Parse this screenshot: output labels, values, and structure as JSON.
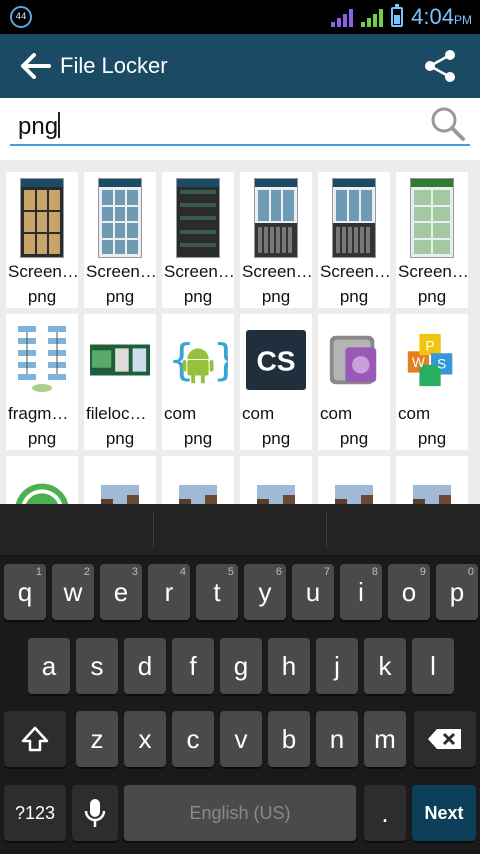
{
  "status": {
    "badge": "44",
    "time": "4:04",
    "ampm": "PM"
  },
  "app": {
    "title": "File Locker"
  },
  "search": {
    "value": "png"
  },
  "files": [
    {
      "name": "Screen…",
      "ext": "png",
      "thumb": "screenshot-grid"
    },
    {
      "name": "Screen…",
      "ext": "png",
      "thumb": "screenshot-light"
    },
    {
      "name": "Screen…",
      "ext": "png",
      "thumb": "screenshot-dark"
    },
    {
      "name": "Screen…",
      "ext": "png",
      "thumb": "screenshot-keyboard"
    },
    {
      "name": "Screen…",
      "ext": "png",
      "thumb": "screenshot-keyboard"
    },
    {
      "name": "Screen…",
      "ext": "png",
      "thumb": "screenshot-chat"
    },
    {
      "name": "fragm…",
      "ext": "png",
      "thumb": "fragment-diagram"
    },
    {
      "name": "fileloc…",
      "ext": "png",
      "thumb": "filelocker-banner"
    },
    {
      "name": "com",
      "ext": "png",
      "thumb": "android-icon"
    },
    {
      "name": "com",
      "ext": "png",
      "thumb": "cs-icon"
    },
    {
      "name": "com",
      "ext": "png",
      "thumb": "safe-icon"
    },
    {
      "name": "com",
      "ext": "png",
      "thumb": "words-icon"
    },
    {
      "name": "",
      "ext": "",
      "thumb": "whatsapp-icon"
    },
    {
      "name": "",
      "ext": "",
      "thumb": "street-photo"
    },
    {
      "name": "",
      "ext": "",
      "thumb": "street-photo"
    },
    {
      "name": "",
      "ext": "",
      "thumb": "street-photo"
    },
    {
      "name": "",
      "ext": "",
      "thumb": "street-photo"
    },
    {
      "name": "",
      "ext": "",
      "thumb": "street-photo"
    }
  ],
  "keyboard": {
    "row1": [
      {
        "k": "q",
        "h": "1"
      },
      {
        "k": "w",
        "h": "2"
      },
      {
        "k": "e",
        "h": "3"
      },
      {
        "k": "r",
        "h": "4"
      },
      {
        "k": "t",
        "h": "5"
      },
      {
        "k": "y",
        "h": "6"
      },
      {
        "k": "u",
        "h": "7"
      },
      {
        "k": "i",
        "h": "8"
      },
      {
        "k": "o",
        "h": "9"
      },
      {
        "k": "p",
        "h": "0"
      }
    ],
    "row2": [
      "a",
      "s",
      "d",
      "f",
      "g",
      "h",
      "j",
      "k",
      "l"
    ],
    "row3": [
      "z",
      "x",
      "c",
      "v",
      "b",
      "n",
      "m"
    ],
    "symbols_label": "?123",
    "space_label": "English (US)",
    "period_label": ".",
    "next_label": "Next"
  }
}
